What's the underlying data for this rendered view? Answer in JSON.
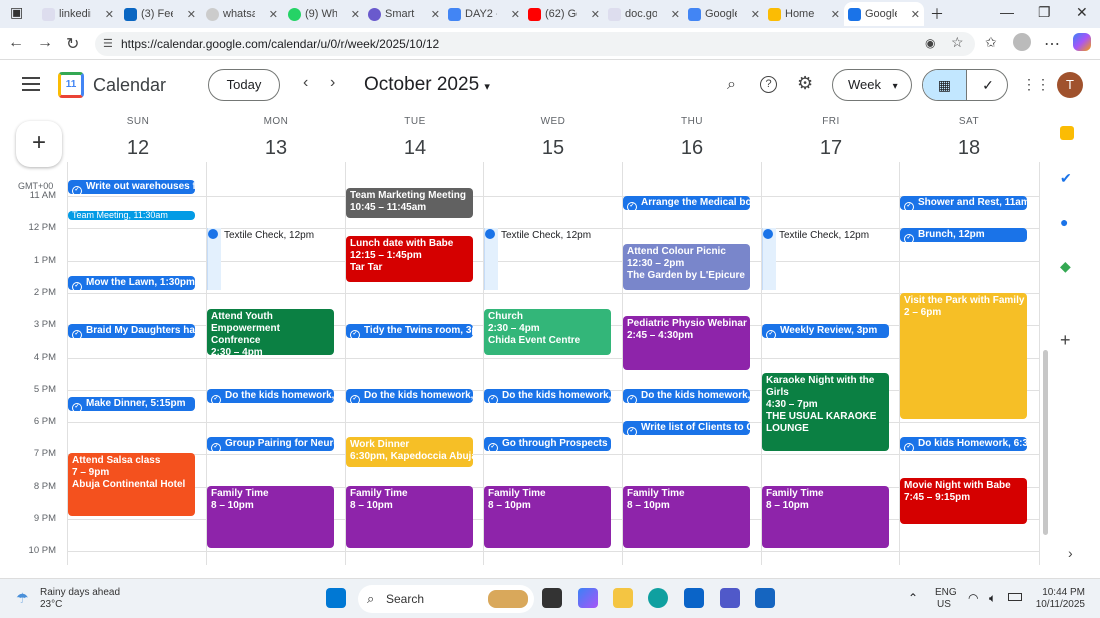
{
  "browser": {
    "tabs": [
      {
        "title": "linkedin",
        "color": "#5f6368"
      },
      {
        "title": "(3) Feed",
        "color": "#0a66c2"
      },
      {
        "title": "whatsapp",
        "color": "#777"
      },
      {
        "title": "(9) WhatsApp",
        "color": "#25d366"
      },
      {
        "title": "Smart",
        "color": "#6a5acd"
      },
      {
        "title": "DAY2 -",
        "color": "#4285f4"
      },
      {
        "title": "(62) Go",
        "color": "#ff0000"
      },
      {
        "title": "doc.go",
        "color": "#5f6368"
      },
      {
        "title": "Google",
        "color": "#4285f4"
      },
      {
        "title": "Home",
        "color": "#fbbc04"
      },
      {
        "title": "Google",
        "color": "#1a73e8"
      }
    ],
    "url": "https://calendar.google.com/calendar/u/0/r/week/2025/10/12"
  },
  "header": {
    "app_title": "Calendar",
    "logo_text": "11",
    "today_label": "Today",
    "month_label": "October 2025",
    "view_label": "Week",
    "avatar_letter": "T"
  },
  "days": [
    {
      "name": "SUN",
      "date": "12"
    },
    {
      "name": "MON",
      "date": "13"
    },
    {
      "name": "TUE",
      "date": "14"
    },
    {
      "name": "WED",
      "date": "15"
    },
    {
      "name": "THU",
      "date": "16"
    },
    {
      "name": "FRI",
      "date": "17"
    },
    {
      "name": "SAT",
      "date": "18"
    }
  ],
  "timezone": "GMT+00",
  "hours": [
    "11 AM",
    "12 PM",
    "1 PM",
    "2 PM",
    "3 PM",
    "4 PM",
    "5 PM",
    "6 PM",
    "7 PM",
    "8 PM",
    "9 PM",
    "10 PM"
  ],
  "colors": {
    "blue": "#1a73e8",
    "cyan": "#039be5",
    "graphite": "#616161",
    "tomato": "#d50000",
    "sage": "#0b8043",
    "mint": "#33b679",
    "lavender": "#7986cb",
    "grape": "#8e24aa",
    "banana": "#f6bf26",
    "tangerine": "#f4511e"
  },
  "events": {
    "sun": {
      "t1": "Write out warehouses fo",
      "t2": "Team Meeting, 11:30am",
      "t3": "Mow the Lawn, 1:30pm",
      "t4": "Braid My Daughters hair",
      "t5": "Make Dinner, 5:15pm",
      "salsa_title": "Attend Salsa class",
      "salsa_time": "7 – 9pm",
      "salsa_loc": "Abuja Continental Hotel"
    },
    "mon": {
      "textile": "Textile Check,",
      "textile_time": "12pm",
      "youth_title": "Attend Youth Empowerment Confrence",
      "youth_time": "2:30 – 4pm",
      "homework": "Do the kids homework,",
      "pairing": "Group Pairing for Neuro",
      "family_title": "Family Time",
      "family_time": "8 – 10pm"
    },
    "tue": {
      "marketing_title": "Team Marketing Meeting",
      "marketing_time": "10:45 – 11:45am",
      "lunch_title": "Lunch date with Babe",
      "lunch_time": "12:15 – 1:45pm",
      "lunch_loc": "Tar Tar",
      "twins": "Tidy the Twins room, 3p",
      "homework": "Do the kids homework,",
      "work_dinner_title": "Work Dinner",
      "work_dinner_time": "6:30pm, Kapedoccia Abuja",
      "family_title": "Family Time",
      "family_time": "8 – 10pm"
    },
    "wed": {
      "textile": "Textile Check,",
      "textile_time": "12pm",
      "church_title": "Church",
      "church_time": "2:30 – 4pm",
      "church_loc": "Chida Event Centre",
      "homework": "Do the kids homework,",
      "prospects": "Go through Prospects le",
      "family_title": "Family Time",
      "family_time": "8 – 10pm"
    },
    "thu": {
      "medical": "Arrange the Medical bo",
      "picnic_title": "Attend Colour Picnic",
      "picnic_time": "12:30 – 2pm",
      "picnic_loc": "The Garden by L'Epicure",
      "physio_title": "Pediatric Physio Webinar",
      "physio_time": "2:45 – 4:30pm",
      "homework": "Do the kids homework,",
      "clients": "Write list of Clients to C",
      "family_title": "Family Time",
      "family_time": "8 – 10pm"
    },
    "fri": {
      "textile": "Textile Check,",
      "textile_time": "12pm",
      "review": "Weekly Review, 3pm",
      "karaoke_title": "Karaoke Night with the Girls",
      "karaoke_time": "4:30 – 7pm",
      "karaoke_loc": "THE USUAL KARAOKE LOUNGE",
      "family_title": "Family Time",
      "family_time": "8 – 10pm"
    },
    "sat": {
      "shower": "Shower and Rest, 11am",
      "brunch": "Brunch, 12pm",
      "park_title": "Visit the Park with Family",
      "park_time": "2 – 6pm",
      "homework": "Do kids Homework, 6:30",
      "movie_title": "Movie Night with Babe",
      "movie_time": "7:45 – 9:15pm"
    }
  },
  "taskbar": {
    "weather_title": "Rainy days ahead",
    "weather_temp": "23°C",
    "search_placeholder": "Search",
    "lang": "ENG",
    "region": "US",
    "time": "10:44 PM",
    "date": "10/11/2025"
  }
}
